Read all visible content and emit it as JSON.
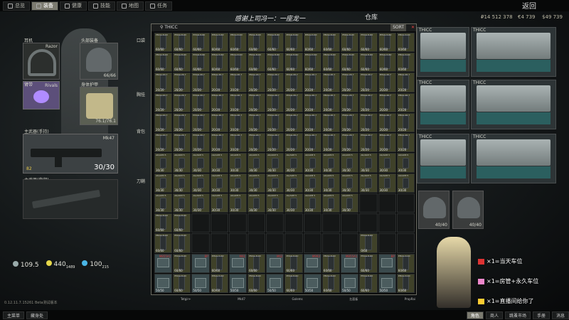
{
  "topbar": {
    "tabs": [
      {
        "label": "总览",
        "active": false,
        "icon": "overview-icon"
      },
      {
        "label": "装备",
        "active": true,
        "icon": "gear-icon"
      },
      {
        "label": "健康",
        "active": false,
        "icon": "health-icon"
      },
      {
        "label": "技能",
        "active": false,
        "icon": "skills-icon"
      },
      {
        "label": "地图",
        "active": false,
        "icon": "map-icon"
      },
      {
        "label": "任务",
        "active": false,
        "icon": "tasks-icon"
      }
    ],
    "return_label": "返回"
  },
  "currency": {
    "roubles": "₽14 512 378",
    "euros": "€4 739",
    "dollars": "$49 739"
  },
  "character_slots": {
    "headset_label": "耳机",
    "headset_item": "Razor",
    "armband_label": "臂带",
    "armband_item": "Rivals",
    "helmet_label": "头部装备",
    "helmet_durability": "66/66",
    "vest_label": "身体护甲",
    "vest_durability": "76.1/76.1",
    "primary_label": "主武器(手持)",
    "primary_item": "Mk47",
    "primary_ammo": "30/30",
    "primary_extra": "82",
    "secondary_label": "主武器(背部)",
    "pouch_label": "口袋",
    "tactical_label": "胸挂",
    "backpack_label": "背包",
    "right_label": "刀鞘"
  },
  "stats": {
    "weight": "109.5",
    "energy": "440",
    "energy_sub": "1489",
    "hydration": "100",
    "hydration_sub": "215"
  },
  "title_banner": "感谢上司冯一：一座龙一",
  "warehouse_label": "仓库",
  "inventory": {
    "title": "THICC",
    "sort_label": "SORT",
    "mag_items": [
      "PMAG D-60",
      "PMAG 20 7",
      "AK/AKM 5"
    ],
    "count_full_60": "60/60",
    "count_full_20": "20/20",
    "count_full_30": "30/30",
    "count_empty": "0/60",
    "ammo_boxes": [
      "M855A1",
      "BP",
      "M61",
      "M62",
      "M993"
    ],
    "ammo_counts": [
      "50/50",
      "50/50",
      "50/50",
      "50/50",
      "50/50"
    ]
  },
  "stash": {
    "container_name": "THICC",
    "helmet_durabilities": [
      "40/40",
      "40/40"
    ]
  },
  "promo": {
    "lines": [
      "×1=当天车位",
      "×1=房管+永久车位",
      "×1=直播间给你了"
    ]
  },
  "bottombar": {
    "left": [
      {
        "label": "主菜单",
        "active": false
      },
      {
        "label": "藏身处",
        "active": false
      }
    ],
    "right": [
      {
        "label": "角色",
        "active": true
      },
      {
        "label": "商人",
        "active": false
      },
      {
        "label": "跳蚤市场",
        "active": false
      },
      {
        "label": "手册",
        "active": false
      },
      {
        "label": "消息",
        "active": false
      }
    ],
    "items_under_inv": [
      "Tetgir+",
      "Mk47",
      "Golems",
      "左面板",
      "PropRai"
    ]
  },
  "beta_text": "0.12.11.7.15261 Beta测试版本",
  "colors": {
    "accent_tab": "#7c7b70",
    "item_yellow": "#3f4129",
    "ammo_teal": "#3a4a4d",
    "warning_red": "#cc3333"
  }
}
